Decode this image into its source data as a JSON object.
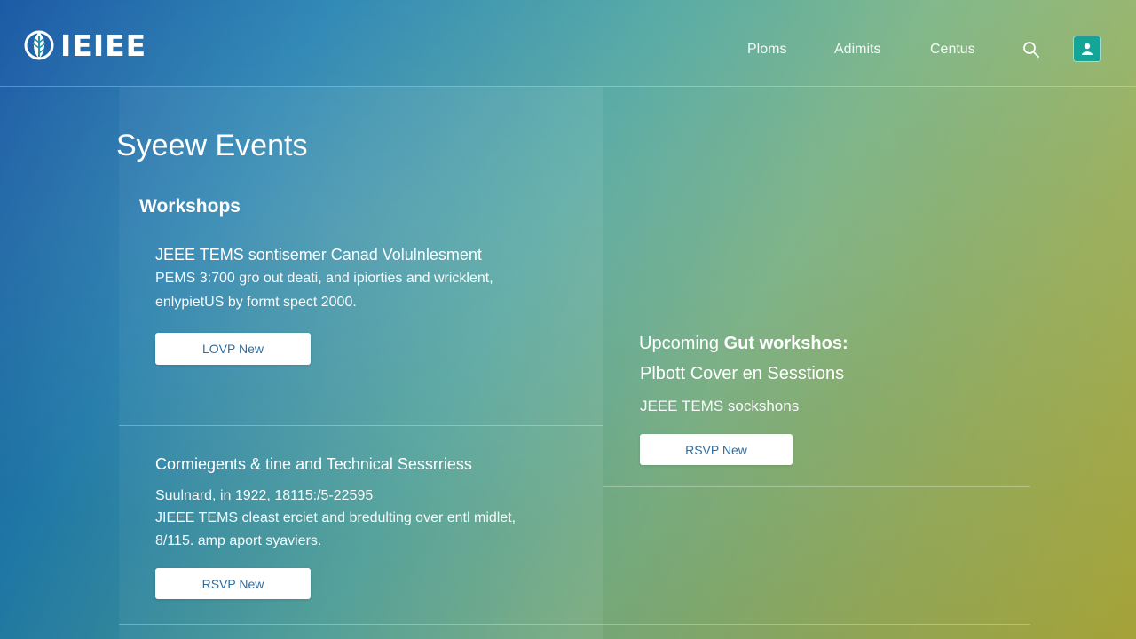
{
  "header": {
    "logo_text": "IEIEE",
    "nav": [
      "Ploms",
      "Adimits",
      "Centus"
    ],
    "icons": {
      "search": "search-icon",
      "user": "user-icon"
    },
    "accent": "#15a596"
  },
  "main": {
    "title": "Syeew Events",
    "section_heading": "Workshops",
    "cards": [
      {
        "title": "JEEE TEMS sontisemer Canad Volulnlesment",
        "lines": [
          "PEMS 3:700 gro out deati, and ipiorties and wricklent,",
          "enlypietUS by formt spect 2000."
        ],
        "button": "LOVP New"
      },
      {
        "title": "Cormiegents & tine and Technical Sessrriess",
        "lines": [
          "Suulnard, in 1922, 18115:/5-22595",
          "JIEEE TEMS cleast erciet and bredulting over entl midlet,",
          "8/115. amp aport syaviers."
        ],
        "button": "RSVP New"
      }
    ]
  },
  "upcoming": {
    "title_light": "Upcoming ",
    "title_bold": "Gut workshos:",
    "subtitle": "Plbott Cover en Sesstions",
    "text": "JEEE TEMS sockshons",
    "button": "RSVP New"
  }
}
